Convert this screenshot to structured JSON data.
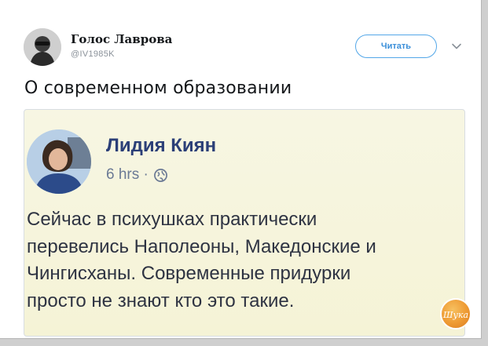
{
  "tweet": {
    "author_name": "Голос Лаврова",
    "author_handle": "@IV1985K",
    "follow_label": "Читать",
    "text": "О современном образовании"
  },
  "embedded_post": {
    "author_name": "Лидия Киян",
    "time": "6 hrs ·",
    "lines": [
      "Сейчас в психушках практически",
      "перевелись Наполеоны, Македонские и",
      "Чингисханы. Современные придурки",
      "просто не знают кто это такие."
    ]
  },
  "watermark": {
    "text": "Шука"
  },
  "colors": {
    "follow_border": "#53a7e8",
    "fb_name": "#2b3f77",
    "embed_bg": "#f7f6e3",
    "watermark": "#ee9a33"
  }
}
